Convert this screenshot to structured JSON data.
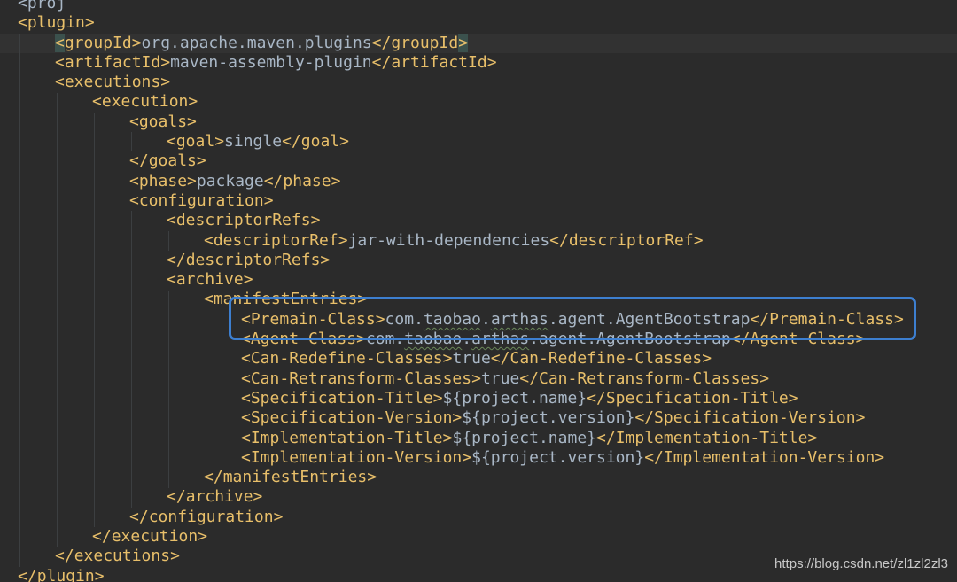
{
  "lines": [
    {
      "indent": 0,
      "segments": [
        {
          "c": "text",
          "t": "<proj"
        }
      ]
    },
    {
      "indent": 0,
      "segments": [
        {
          "c": "bracket",
          "t": "<"
        },
        {
          "c": "tag",
          "t": "plugin"
        },
        {
          "c": "bracket",
          "t": ">"
        }
      ]
    },
    {
      "indent": 1,
      "caret": true,
      "segments": [
        {
          "c": "bracket match",
          "t": "<"
        },
        {
          "c": "tag",
          "t": "groupId"
        },
        {
          "c": "bracket",
          "t": ">"
        },
        {
          "c": "text",
          "t": "org.apache.maven.plugins"
        },
        {
          "c": "bracket",
          "t": "</"
        },
        {
          "c": "tag",
          "t": "groupId"
        },
        {
          "c": "bracket match",
          "t": ">"
        }
      ]
    },
    {
      "indent": 1,
      "segments": [
        {
          "c": "bracket",
          "t": "<"
        },
        {
          "c": "tag",
          "t": "artifactId"
        },
        {
          "c": "bracket",
          "t": ">"
        },
        {
          "c": "text",
          "t": "maven-assembly-plugin"
        },
        {
          "c": "bracket",
          "t": "</"
        },
        {
          "c": "tag",
          "t": "artifactId"
        },
        {
          "c": "bracket",
          "t": ">"
        }
      ]
    },
    {
      "indent": 1,
      "segments": [
        {
          "c": "bracket",
          "t": "<"
        },
        {
          "c": "tag",
          "t": "executions"
        },
        {
          "c": "bracket",
          "t": ">"
        }
      ]
    },
    {
      "indent": 2,
      "segments": [
        {
          "c": "bracket",
          "t": "<"
        },
        {
          "c": "tag",
          "t": "execution"
        },
        {
          "c": "bracket",
          "t": ">"
        }
      ]
    },
    {
      "indent": 3,
      "segments": [
        {
          "c": "bracket",
          "t": "<"
        },
        {
          "c": "tag",
          "t": "goals"
        },
        {
          "c": "bracket",
          "t": ">"
        }
      ]
    },
    {
      "indent": 4,
      "segments": [
        {
          "c": "bracket",
          "t": "<"
        },
        {
          "c": "tag",
          "t": "goal"
        },
        {
          "c": "bracket",
          "t": ">"
        },
        {
          "c": "text",
          "t": "single"
        },
        {
          "c": "bracket",
          "t": "</"
        },
        {
          "c": "tag",
          "t": "goal"
        },
        {
          "c": "bracket",
          "t": ">"
        }
      ]
    },
    {
      "indent": 3,
      "segments": [
        {
          "c": "bracket",
          "t": "</"
        },
        {
          "c": "tag",
          "t": "goals"
        },
        {
          "c": "bracket",
          "t": ">"
        }
      ]
    },
    {
      "indent": 3,
      "segments": [
        {
          "c": "bracket",
          "t": "<"
        },
        {
          "c": "tag",
          "t": "phase"
        },
        {
          "c": "bracket",
          "t": ">"
        },
        {
          "c": "text",
          "t": "package"
        },
        {
          "c": "bracket",
          "t": "</"
        },
        {
          "c": "tag",
          "t": "phase"
        },
        {
          "c": "bracket",
          "t": ">"
        }
      ]
    },
    {
      "indent": 3,
      "segments": [
        {
          "c": "bracket",
          "t": "<"
        },
        {
          "c": "tag",
          "t": "configuration"
        },
        {
          "c": "bracket",
          "t": ">"
        }
      ]
    },
    {
      "indent": 4,
      "segments": [
        {
          "c": "bracket",
          "t": "<"
        },
        {
          "c": "tag",
          "t": "descriptorRefs"
        },
        {
          "c": "bracket",
          "t": ">"
        }
      ]
    },
    {
      "indent": 5,
      "segments": [
        {
          "c": "bracket",
          "t": "<"
        },
        {
          "c": "tag",
          "t": "descriptorRef"
        },
        {
          "c": "bracket",
          "t": ">"
        },
        {
          "c": "text",
          "t": "jar-with-dependencies"
        },
        {
          "c": "bracket",
          "t": "</"
        },
        {
          "c": "tag",
          "t": "descriptorRef"
        },
        {
          "c": "bracket",
          "t": ">"
        }
      ]
    },
    {
      "indent": 4,
      "segments": [
        {
          "c": "bracket",
          "t": "</"
        },
        {
          "c": "tag",
          "t": "descriptorRefs"
        },
        {
          "c": "bracket",
          "t": ">"
        }
      ]
    },
    {
      "indent": 4,
      "segments": [
        {
          "c": "bracket",
          "t": "<"
        },
        {
          "c": "tag",
          "t": "archive"
        },
        {
          "c": "bracket",
          "t": ">"
        }
      ]
    },
    {
      "indent": 5,
      "segments": [
        {
          "c": "bracket",
          "t": "<"
        },
        {
          "c": "tag",
          "t": "manifestEntries"
        },
        {
          "c": "bracket",
          "t": ">"
        }
      ]
    },
    {
      "indent": 6,
      "segments": [
        {
          "c": "bracket",
          "t": "<"
        },
        {
          "c": "tag",
          "t": "Premain-Class"
        },
        {
          "c": "bracket",
          "t": ">"
        },
        {
          "c": "text",
          "t": "com."
        },
        {
          "c": "text squiggle",
          "t": "taobao"
        },
        {
          "c": "text",
          "t": "."
        },
        {
          "c": "text squiggle",
          "t": "arthas"
        },
        {
          "c": "text",
          "t": ".agent.AgentBootstrap"
        },
        {
          "c": "bracket",
          "t": "</"
        },
        {
          "c": "tag",
          "t": "Premain-Class"
        },
        {
          "c": "bracket",
          "t": ">"
        }
      ]
    },
    {
      "indent": 6,
      "segments": [
        {
          "c": "bracket",
          "t": "<"
        },
        {
          "c": "tag",
          "t": "Agent-Class"
        },
        {
          "c": "bracket",
          "t": ">"
        },
        {
          "c": "text",
          "t": "com."
        },
        {
          "c": "text squiggle",
          "t": "taobao"
        },
        {
          "c": "text",
          "t": "."
        },
        {
          "c": "text squiggle",
          "t": "arthas"
        },
        {
          "c": "text",
          "t": ".agent.AgentBootstrap"
        },
        {
          "c": "bracket",
          "t": "</"
        },
        {
          "c": "tag",
          "t": "Agent-Class"
        },
        {
          "c": "bracket",
          "t": ">"
        }
      ]
    },
    {
      "indent": 6,
      "segments": [
        {
          "c": "bracket",
          "t": "<"
        },
        {
          "c": "tag",
          "t": "Can-Redefine-Classes"
        },
        {
          "c": "bracket",
          "t": ">"
        },
        {
          "c": "text",
          "t": "true"
        },
        {
          "c": "bracket",
          "t": "</"
        },
        {
          "c": "tag",
          "t": "Can-Redefine-Classes"
        },
        {
          "c": "bracket",
          "t": ">"
        }
      ]
    },
    {
      "indent": 6,
      "segments": [
        {
          "c": "bracket",
          "t": "<"
        },
        {
          "c": "tag",
          "t": "Can-Retransform-Classes"
        },
        {
          "c": "bracket",
          "t": ">"
        },
        {
          "c": "text",
          "t": "true"
        },
        {
          "c": "bracket",
          "t": "</"
        },
        {
          "c": "tag",
          "t": "Can-Retransform-Classes"
        },
        {
          "c": "bracket",
          "t": ">"
        }
      ]
    },
    {
      "indent": 6,
      "segments": [
        {
          "c": "bracket",
          "t": "<"
        },
        {
          "c": "tag",
          "t": "Specification-Title"
        },
        {
          "c": "bracket",
          "t": ">"
        },
        {
          "c": "text",
          "t": "${project.name}"
        },
        {
          "c": "bracket",
          "t": "</"
        },
        {
          "c": "tag",
          "t": "Specification-Title"
        },
        {
          "c": "bracket",
          "t": ">"
        }
      ]
    },
    {
      "indent": 6,
      "segments": [
        {
          "c": "bracket",
          "t": "<"
        },
        {
          "c": "tag",
          "t": "Specification-Version"
        },
        {
          "c": "bracket",
          "t": ">"
        },
        {
          "c": "text",
          "t": "${project.version}"
        },
        {
          "c": "bracket",
          "t": "</"
        },
        {
          "c": "tag",
          "t": "Specification-Version"
        },
        {
          "c": "bracket",
          "t": ">"
        }
      ]
    },
    {
      "indent": 6,
      "segments": [
        {
          "c": "bracket",
          "t": "<"
        },
        {
          "c": "tag",
          "t": "Implementation-Title"
        },
        {
          "c": "bracket",
          "t": ">"
        },
        {
          "c": "text",
          "t": "${project.name}"
        },
        {
          "c": "bracket",
          "t": "</"
        },
        {
          "c": "tag",
          "t": "Implementation-Title"
        },
        {
          "c": "bracket",
          "t": ">"
        }
      ]
    },
    {
      "indent": 6,
      "segments": [
        {
          "c": "bracket",
          "t": "<"
        },
        {
          "c": "tag",
          "t": "Implementation-Version"
        },
        {
          "c": "bracket",
          "t": ">"
        },
        {
          "c": "text",
          "t": "${project.version}"
        },
        {
          "c": "bracket",
          "t": "</"
        },
        {
          "c": "tag",
          "t": "Implementation-Version"
        },
        {
          "c": "bracket",
          "t": ">"
        }
      ]
    },
    {
      "indent": 5,
      "segments": [
        {
          "c": "bracket",
          "t": "</"
        },
        {
          "c": "tag",
          "t": "manifestEntries"
        },
        {
          "c": "bracket",
          "t": ">"
        }
      ]
    },
    {
      "indent": 4,
      "segments": [
        {
          "c": "bracket",
          "t": "</"
        },
        {
          "c": "tag",
          "t": "archive"
        },
        {
          "c": "bracket",
          "t": ">"
        }
      ]
    },
    {
      "indent": 3,
      "segments": [
        {
          "c": "bracket",
          "t": "</"
        },
        {
          "c": "tag",
          "t": "configuration"
        },
        {
          "c": "bracket",
          "t": ">"
        }
      ]
    },
    {
      "indent": 2,
      "segments": [
        {
          "c": "bracket",
          "t": "</"
        },
        {
          "c": "tag",
          "t": "execution"
        },
        {
          "c": "bracket",
          "t": ">"
        }
      ]
    },
    {
      "indent": 1,
      "segments": [
        {
          "c": "bracket",
          "t": "</"
        },
        {
          "c": "tag",
          "t": "executions"
        },
        {
          "c": "bracket",
          "t": ">"
        }
      ]
    },
    {
      "indent": 0,
      "segments": [
        {
          "c": "bracket",
          "t": "</"
        },
        {
          "c": "tag",
          "t": "plugin"
        },
        {
          "c": "bracket",
          "t": ">"
        }
      ]
    }
  ],
  "watermark": "https://blog.csdn.net/zl1zl2zl3",
  "colors": {
    "background": "#2b2b2b",
    "tag": "#e8bf6a",
    "text": "#a9b7c6",
    "highlight_border": "#3d7fd0"
  }
}
